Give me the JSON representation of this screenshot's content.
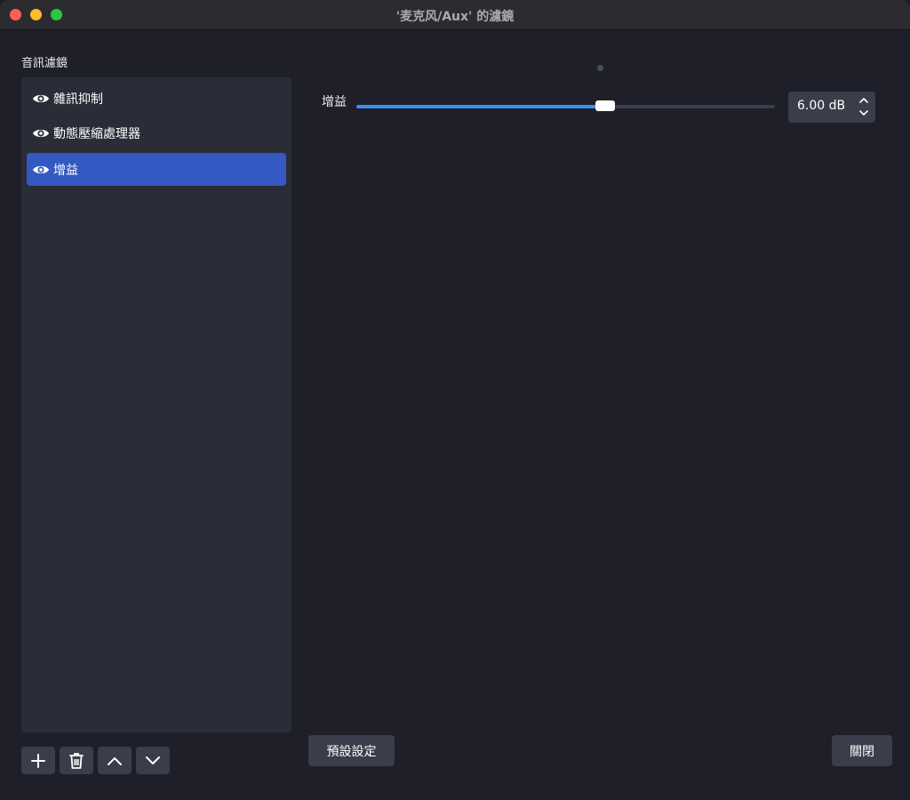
{
  "window": {
    "title": "'麦克风/Aux' 的濾鏡"
  },
  "sidebar": {
    "section_label": "音訊濾鏡",
    "filters": [
      {
        "label": "雜訊抑制",
        "visible": true,
        "selected": false
      },
      {
        "label": "動態壓縮處理器",
        "visible": true,
        "selected": false
      },
      {
        "label": "增益",
        "visible": true,
        "selected": true
      }
    ],
    "toolbar": {
      "add_icon": "plus-icon",
      "remove_icon": "trash-icon",
      "move_up_icon": "chevron-up-icon",
      "move_down_icon": "chevron-down-icon"
    }
  },
  "properties": {
    "gain": {
      "label": "增益",
      "value_text": "6.00 dB",
      "slider_fraction": 0.595
    }
  },
  "footer": {
    "defaults_label": "預設設定",
    "close_label": "關閉"
  },
  "colors": {
    "accent": "#3c8ef1",
    "selection": "#3559c2",
    "background": "#1e1f28",
    "panel": "#2a2c37"
  }
}
